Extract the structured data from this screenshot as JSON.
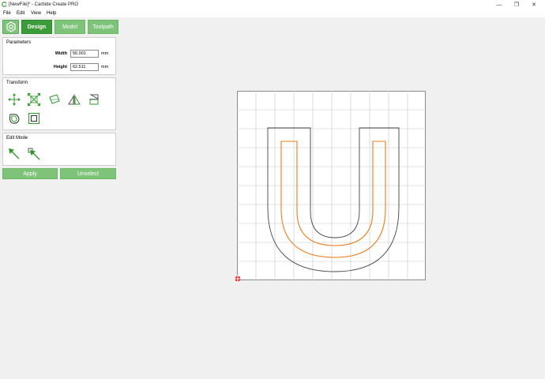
{
  "window": {
    "title": "[NewFile]* - Carbide Create PRO",
    "minimize_glyph": "—",
    "maximize_glyph": "❐",
    "close_glyph": "✕",
    "app_icon": "carbide-logo-icon"
  },
  "menu": {
    "items": [
      {
        "label": "File"
      },
      {
        "label": "Edit"
      },
      {
        "label": "View"
      },
      {
        "label": "Help"
      }
    ]
  },
  "toolbar": {
    "settings_icon": "gear-icon",
    "tabs": [
      {
        "label": "Design",
        "active": true
      },
      {
        "label": "Model",
        "active": false
      },
      {
        "label": "Toolpath",
        "active": false
      }
    ]
  },
  "parameters": {
    "title": "Parameters",
    "width_label": "Width",
    "width_value": "56.001",
    "width_unit": "mm",
    "height_label": "Height",
    "height_value": "62.511",
    "height_unit": "mm"
  },
  "transform": {
    "title": "Transform",
    "tools": [
      {
        "icon": "move-icon"
      },
      {
        "icon": "scale-icon"
      },
      {
        "icon": "rotate-icon"
      },
      {
        "icon": "mirror-icon"
      },
      {
        "icon": "align-icon"
      },
      {
        "icon": "offset-icon"
      },
      {
        "icon": "node-edit-icon"
      }
    ]
  },
  "edit_mode": {
    "title": "Edit Mode",
    "tools": [
      {
        "icon": "select-arrow-icon"
      },
      {
        "icon": "node-select-arrow-icon"
      }
    ]
  },
  "actions": {
    "apply_label": "Apply",
    "unselect_label": "Unselect"
  },
  "colors": {
    "accent": "#7dc37a",
    "accent_active": "#3d9c3a",
    "selected_path": "#f07b1b",
    "outline_path": "#444444",
    "grid": "#c8c8c8",
    "origin": "#e02020"
  }
}
